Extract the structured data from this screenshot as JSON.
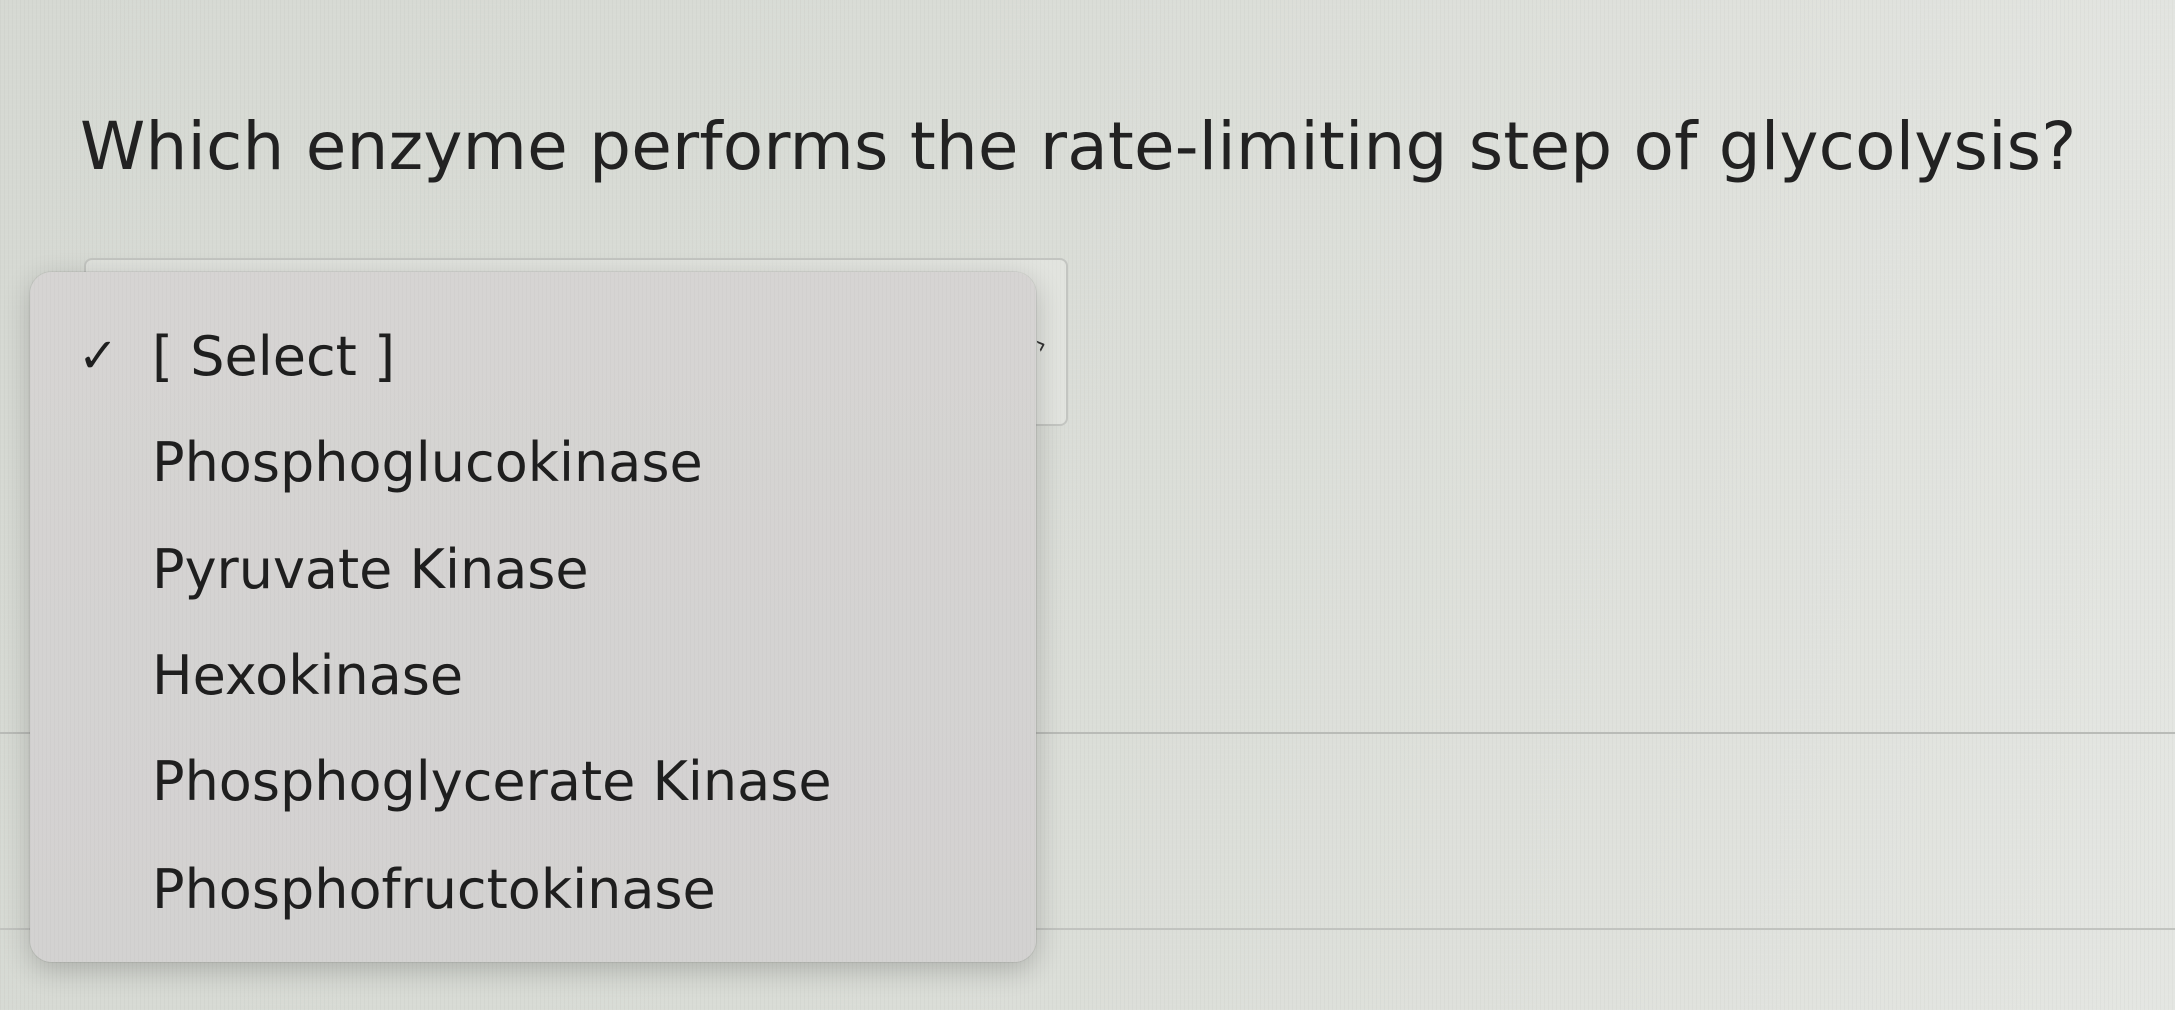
{
  "question": {
    "text": "Which enzyme performs the rate-limiting step of glycolysis?"
  },
  "select": {
    "selected": "[ Select ]",
    "caret_icon": "chevron-down-icon"
  },
  "dropdown": {
    "check_glyph": "✓",
    "options": [
      {
        "label": "[ Select ]",
        "checked": true
      },
      {
        "label": "Phosphoglucokinase",
        "checked": false
      },
      {
        "label": "Pyruvate Kinase",
        "checked": false
      },
      {
        "label": "Hexokinase",
        "checked": false
      },
      {
        "label": "Phosphoglycerate Kinase",
        "checked": false
      },
      {
        "label": "Phosphofructokinase",
        "checked": false
      }
    ]
  },
  "colors": {
    "background": "#d9dcd6",
    "menu_background": "#d4d3d2",
    "text": "#1f1f1f"
  }
}
